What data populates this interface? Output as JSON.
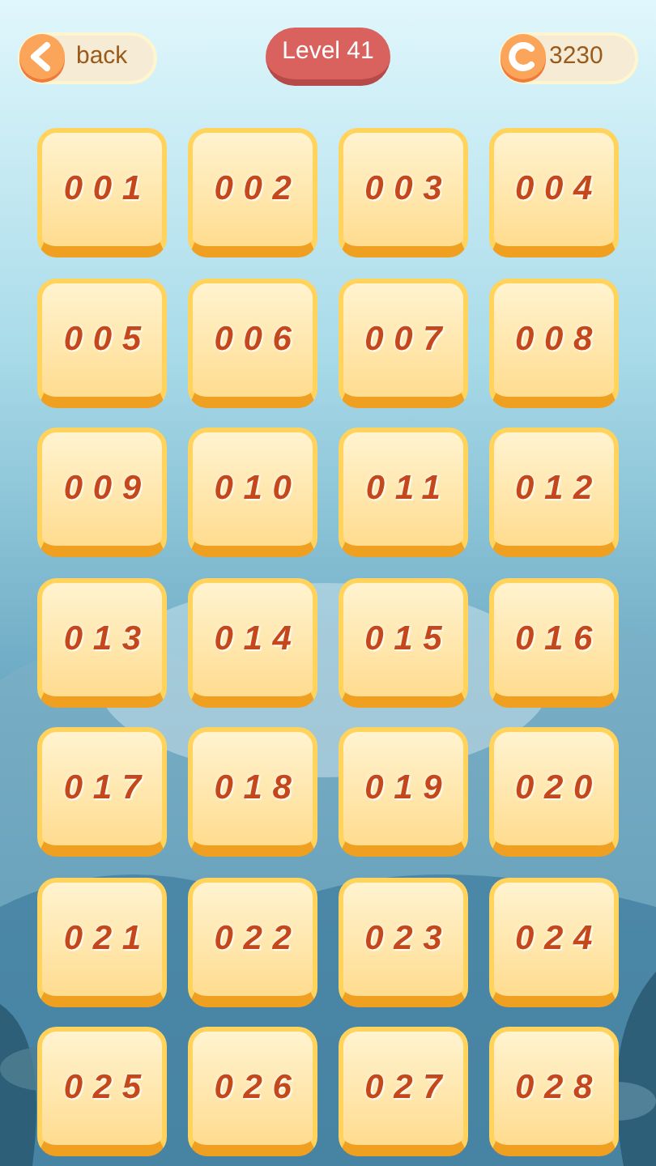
{
  "back_button": {
    "label": "back"
  },
  "level_badge": {
    "label": "Level 41"
  },
  "coins": {
    "amount": "3230"
  },
  "levels": [
    {
      "label": "001"
    },
    {
      "label": "002"
    },
    {
      "label": "003"
    },
    {
      "label": "004"
    },
    {
      "label": "005"
    },
    {
      "label": "006"
    },
    {
      "label": "007"
    },
    {
      "label": "008"
    },
    {
      "label": "009"
    },
    {
      "label": "010"
    },
    {
      "label": "011"
    },
    {
      "label": "012"
    },
    {
      "label": "013"
    },
    {
      "label": "014"
    },
    {
      "label": "015"
    },
    {
      "label": "016"
    },
    {
      "label": "017"
    },
    {
      "label": "018"
    },
    {
      "label": "019"
    },
    {
      "label": "020"
    },
    {
      "label": "021"
    },
    {
      "label": "022"
    },
    {
      "label": "023"
    },
    {
      "label": "024"
    },
    {
      "label": "025"
    },
    {
      "label": "026"
    },
    {
      "label": "027"
    },
    {
      "label": "028"
    }
  ]
}
